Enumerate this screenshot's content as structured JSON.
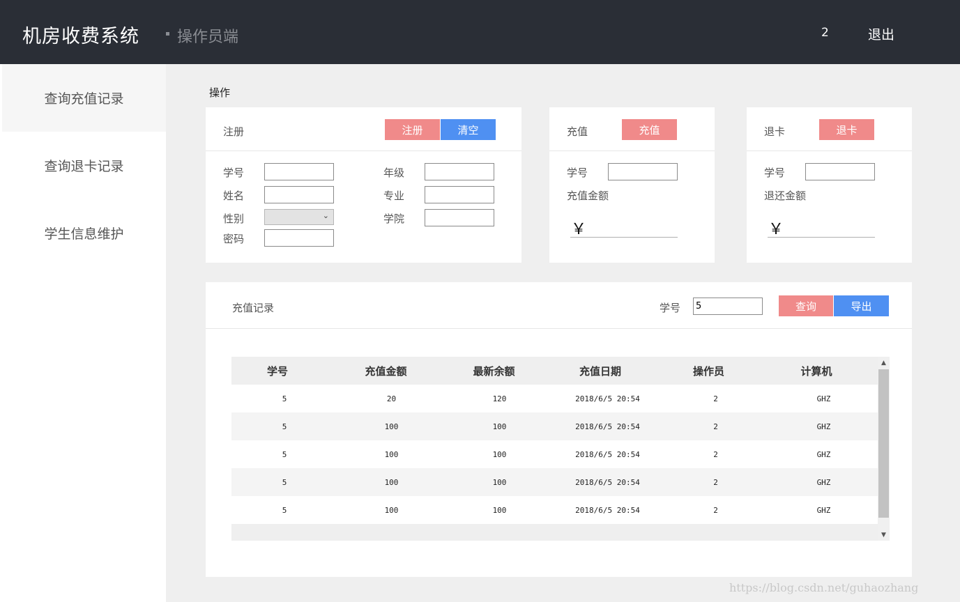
{
  "header": {
    "title": "机房收费系统",
    "subtitle": "操作员端",
    "user": "2",
    "logout": "退出"
  },
  "sidebar": {
    "items": [
      {
        "label": "查询充值记录"
      },
      {
        "label": "查询退卡记录"
      },
      {
        "label": "学生信息维护"
      }
    ]
  },
  "section_label": "操作",
  "register": {
    "title": "注册",
    "register_btn": "注册",
    "clear_btn": "清空",
    "fields": {
      "student_id": "学号",
      "name": "姓名",
      "gender": "性别",
      "password": "密码",
      "grade": "年级",
      "major": "专业",
      "college": "学院"
    }
  },
  "recharge": {
    "title": "充值",
    "btn": "充值",
    "student_id": "学号",
    "amount_label": "充值金额",
    "currency": "￥"
  },
  "refund": {
    "title": "退卡",
    "btn": "退卡",
    "student_id": "学号",
    "amount_label": "退还金额",
    "currency": "￥"
  },
  "records": {
    "title": "充值记录",
    "search_label": "学号",
    "search_value": "5",
    "query_btn": "查询",
    "export_btn": "导出",
    "columns": [
      "学号",
      "充值金额",
      "最新余额",
      "充值日期",
      "操作员",
      "计算机"
    ],
    "rows": [
      [
        "5",
        "20",
        "120",
        "2018/6/5 20:54",
        "2",
        "GHZ"
      ],
      [
        "5",
        "100",
        "100",
        "2018/6/5 20:54",
        "2",
        "GHZ"
      ],
      [
        "5",
        "100",
        "100",
        "2018/6/5 20:54",
        "2",
        "GHZ"
      ],
      [
        "5",
        "100",
        "100",
        "2018/6/5 20:54",
        "2",
        "GHZ"
      ],
      [
        "5",
        "100",
        "100",
        "2018/6/5 20:54",
        "2",
        "GHZ"
      ]
    ]
  },
  "watermark": "https://blog.csdn.net/guhaozhang",
  "colors": {
    "header_bg": "#2a2e36",
    "btn_red": "#f08a8a",
    "btn_blue": "#4f90f2"
  }
}
